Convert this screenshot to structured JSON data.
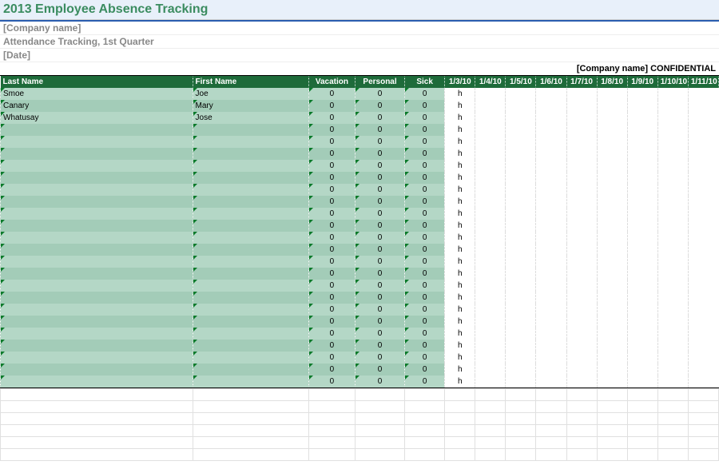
{
  "title": "2013 Employee Absence Tracking",
  "meta": {
    "company": "[Company name]",
    "subtitle": "Attendance Tracking, 1st Quarter",
    "date": "[Date]"
  },
  "confidential": "[Company name] CONFIDENTIAL",
  "headers": {
    "last": "Last Name",
    "first": "First Name",
    "vacation": "Vacation",
    "personal": "Personal",
    "sick": "Sick",
    "dates": [
      "1/3/10",
      "1/4/10",
      "1/5/10",
      "1/6/10",
      "1/7/10",
      "1/8/10",
      "1/9/10",
      "1/10/10",
      "1/11/10"
    ]
  },
  "rows": [
    {
      "last": "Smoe",
      "first": "Joe",
      "v": "0",
      "p": "0",
      "s": "0",
      "h": "h"
    },
    {
      "last": "Canary",
      "first": "Mary",
      "v": "0",
      "p": "0",
      "s": "0",
      "h": "h"
    },
    {
      "last": "Whatusay",
      "first": "Jose",
      "v": "0",
      "p": "0",
      "s": "0",
      "h": "h"
    },
    {
      "last": "",
      "first": "",
      "v": "0",
      "p": "0",
      "s": "0",
      "h": "h"
    },
    {
      "last": "",
      "first": "",
      "v": "0",
      "p": "0",
      "s": "0",
      "h": "h"
    },
    {
      "last": "",
      "first": "",
      "v": "0",
      "p": "0",
      "s": "0",
      "h": "h"
    },
    {
      "last": "",
      "first": "",
      "v": "0",
      "p": "0",
      "s": "0",
      "h": "h"
    },
    {
      "last": "",
      "first": "",
      "v": "0",
      "p": "0",
      "s": "0",
      "h": "h"
    },
    {
      "last": "",
      "first": "",
      "v": "0",
      "p": "0",
      "s": "0",
      "h": "h"
    },
    {
      "last": "",
      "first": "",
      "v": "0",
      "p": "0",
      "s": "0",
      "h": "h"
    },
    {
      "last": "",
      "first": "",
      "v": "0",
      "p": "0",
      "s": "0",
      "h": "h"
    },
    {
      "last": "",
      "first": "",
      "v": "0",
      "p": "0",
      "s": "0",
      "h": "h"
    },
    {
      "last": "",
      "first": "",
      "v": "0",
      "p": "0",
      "s": "0",
      "h": "h"
    },
    {
      "last": "",
      "first": "",
      "v": "0",
      "p": "0",
      "s": "0",
      "h": "h"
    },
    {
      "last": "",
      "first": "",
      "v": "0",
      "p": "0",
      "s": "0",
      "h": "h"
    },
    {
      "last": "",
      "first": "",
      "v": "0",
      "p": "0",
      "s": "0",
      "h": "h"
    },
    {
      "last": "",
      "first": "",
      "v": "0",
      "p": "0",
      "s": "0",
      "h": "h"
    },
    {
      "last": "",
      "first": "",
      "v": "0",
      "p": "0",
      "s": "0",
      "h": "h"
    },
    {
      "last": "",
      "first": "",
      "v": "0",
      "p": "0",
      "s": "0",
      "h": "h"
    },
    {
      "last": "",
      "first": "",
      "v": "0",
      "p": "0",
      "s": "0",
      "h": "h"
    },
    {
      "last": "",
      "first": "",
      "v": "0",
      "p": "0",
      "s": "0",
      "h": "h"
    },
    {
      "last": "",
      "first": "",
      "v": "0",
      "p": "0",
      "s": "0",
      "h": "h"
    },
    {
      "last": "",
      "first": "",
      "v": "0",
      "p": "0",
      "s": "0",
      "h": "h"
    },
    {
      "last": "",
      "first": "",
      "v": "0",
      "p": "0",
      "s": "0",
      "h": "h"
    },
    {
      "last": "",
      "first": "",
      "v": "0",
      "p": "0",
      "s": "0",
      "h": "h"
    }
  ],
  "blank_row_count": 6
}
